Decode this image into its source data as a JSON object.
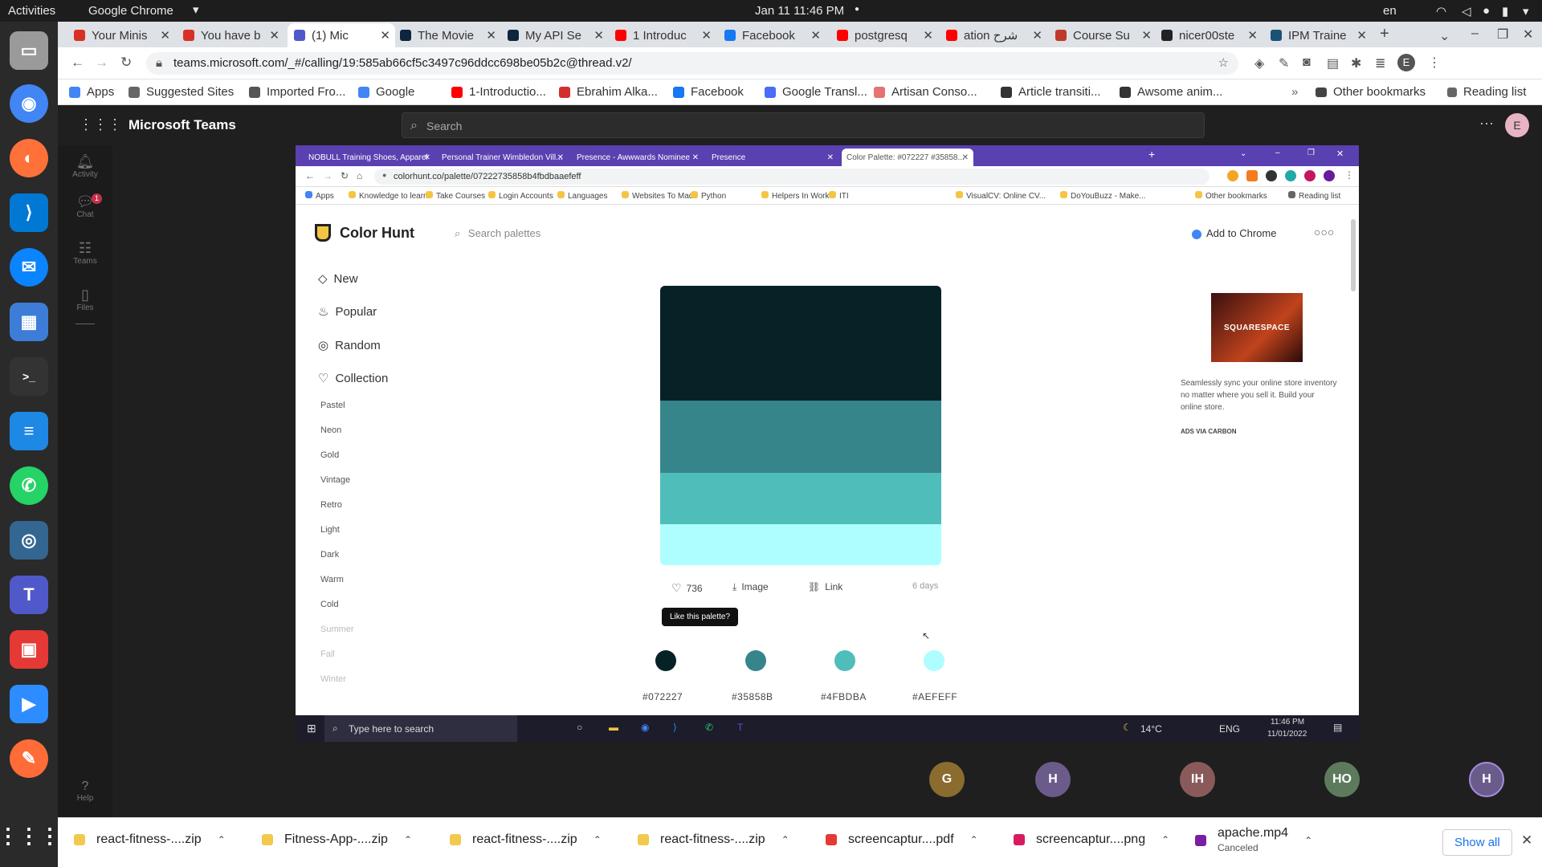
{
  "topbar": {
    "activities": "Activities",
    "app": "Google Chrome",
    "clock": "Jan 11  11:46 PM",
    "lang": "en"
  },
  "dock": {
    "items": [
      "files-icon",
      "chrome-icon",
      "firefox-icon",
      "vscode-icon",
      "thunderbird-icon",
      "software-icon",
      "terminal-icon",
      "writer-icon",
      "whatsapp-icon",
      "postgres-icon",
      "teams-icon",
      "screenshot-icon",
      "zoom-icon",
      "postman-icon",
      "apps-grid-icon"
    ]
  },
  "chrome": {
    "tabs": [
      {
        "label": "Your Minis",
        "color": "#d93025"
      },
      {
        "label": "You have b",
        "color": "#d93025"
      },
      {
        "label": "(1) Mic",
        "color": "#5059c9",
        "active": true
      },
      {
        "label": "The Movie",
        "color": "#0d253f"
      },
      {
        "label": "My API Se",
        "color": "#0d253f"
      },
      {
        "label": "1 Introduc",
        "color": "#ff0000"
      },
      {
        "label": "Facebook",
        "color": "#1877f2"
      },
      {
        "label": "postgresq",
        "color": "#ff0000"
      },
      {
        "label": "ation شرح",
        "color": "#ff0000"
      },
      {
        "label": "Course Su",
        "color": "#c0392b"
      },
      {
        "label": "nicer00ste",
        "color": "#222222"
      },
      {
        "label": "IPM Traine",
        "color": "#1a5276"
      }
    ],
    "url": "teams.microsoft.com/_#/calling/19:585ab66cf5c3497c96ddcc698be05b2c@thread.v2/",
    "bookmarks": [
      "Apps",
      "Suggested Sites",
      "Imported Fro...",
      "Google",
      "1-Introductio...",
      "Ebrahim Alka...",
      "Facebook",
      "Google Transl...",
      "Artisan Conso...",
      "Article transiti...",
      "Awsome anim..."
    ],
    "other_bookmarks": "Other bookmarks",
    "reading_list": "Reading list"
  },
  "teams": {
    "title": "Microsoft Teams",
    "search_placeholder": "Search",
    "user_initial": "E",
    "rail": [
      {
        "label": "Activity"
      },
      {
        "label": "Chat",
        "badge": "1"
      },
      {
        "label": "Teams"
      },
      {
        "label": "Files"
      }
    ],
    "help": "Help"
  },
  "shared": {
    "tabs": [
      "NOBULL Training Shoes, Apparel",
      "Personal Trainer Wimbledon Vill...",
      "Presence - Awwwards Nominee",
      "Presence",
      "Color Palette: #072227 #35858..."
    ],
    "url": "colorhunt.co/palette/07222735858b4fbdbaaefeff",
    "bookmarks": [
      "Apps",
      "Knowledge to learn",
      "Take Courses",
      "Login Accounts",
      "Languages",
      "Websites To Made",
      "Python",
      "Helpers In Work",
      "ITI",
      "VisualCV: Online CV...",
      "DoYouBuzz - Make..."
    ],
    "other_bookmarks": "Other bookmarks",
    "reading_list": "Reading list",
    "site": {
      "brand": "Color Hunt",
      "search_placeholder": "Search palettes",
      "add_to_chrome": "Add to Chrome",
      "nav": [
        "New",
        "Popular",
        "Random",
        "Collection"
      ],
      "categories": [
        "Pastel",
        "Neon",
        "Gold",
        "Vintage",
        "Retro",
        "Light",
        "Dark",
        "Warm",
        "Cold",
        "Summer",
        "Fall",
        "Winter"
      ],
      "palette": [
        "#072227",
        "#35858B",
        "#4FBDBA",
        "#AEFEFF"
      ],
      "likes": "736",
      "image_label": "Image",
      "link_label": "Link",
      "age": "6 days",
      "tooltip": "Like this palette?",
      "ad_text": "Seamlessly sync your online store inventory no matter where you sell it. Build your online store.",
      "ad_brand": "SQUARESPACE",
      "ad_via": "ADS VIA CARBON"
    },
    "taskbar": {
      "search": "Type here to search",
      "temp": "14°C",
      "lang": "ENG",
      "time": "11:46 PM",
      "date": "11/01/2022"
    }
  },
  "participants": [
    {
      "initials": "G",
      "color": "#8a6d2e"
    },
    {
      "initials": "H",
      "color": "#6b5b8a"
    },
    {
      "initials": "IH",
      "color": "#8a5a5a"
    },
    {
      "initials": "HO",
      "color": "#5d7a5d"
    },
    {
      "initials": "H",
      "color": "#6b5b8a"
    }
  ],
  "downloads": {
    "items": [
      {
        "name": "react-fitness-....zip",
        "color": "#f2c94c"
      },
      {
        "name": "Fitness-App-....zip",
        "color": "#f2c94c"
      },
      {
        "name": "react-fitness-....zip",
        "color": "#f2c94c"
      },
      {
        "name": "react-fitness-....zip",
        "color": "#f2c94c"
      },
      {
        "name": "screencaptur....pdf",
        "color": "#e53935"
      },
      {
        "name": "screencaptur....png",
        "color": "#d81b60"
      },
      {
        "name": "apache.mp4",
        "sub": "Canceled",
        "color": "#7b1fa2"
      }
    ],
    "show_all": "Show all"
  }
}
